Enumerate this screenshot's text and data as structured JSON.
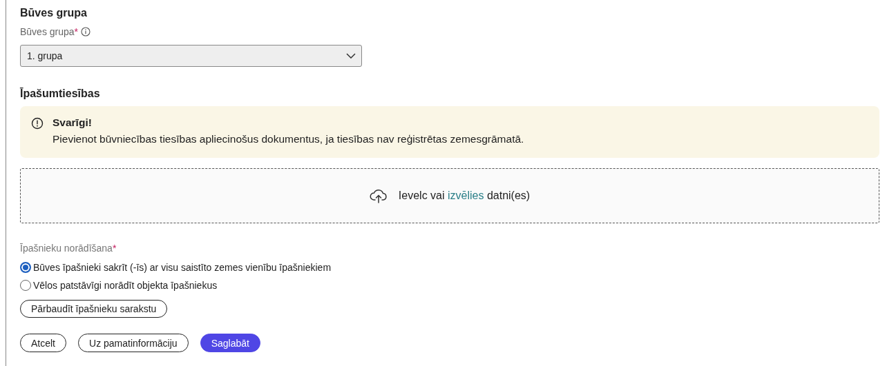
{
  "group_section": {
    "title": "Būves grupa",
    "field": {
      "label": "Būves grupa",
      "required_mark": "*",
      "value": "1. grupa"
    }
  },
  "ownership_section": {
    "title": "Īpašumtiesības",
    "alert": {
      "title": "Svarīgi!",
      "message": "Pievienot būvniecības tiesības apliecinošus dokumentus, ja tiesības nav reģistrētas zemesgrāmatā."
    },
    "dropzone": {
      "before": "Ievelc vai",
      "link": "izvēlies",
      "after": "datni(es)"
    },
    "owners": {
      "label": "Īpašnieku norādīšana",
      "required_mark": "*",
      "options": [
        {
          "label": "Būves īpašnieki sakrīt (-īs) ar visu saistīto zemes vienību īpašniekiem",
          "selected": true
        },
        {
          "label": "Vēlos patstāvīgi norādīt objekta īpašniekus",
          "selected": false
        }
      ]
    },
    "check_button": "Pārbaudīt īpašnieku sarakstu"
  },
  "actions": [
    {
      "label": "Atcelt",
      "kind": "outline"
    },
    {
      "label": "Uz pamatinformāciju",
      "kind": "outline"
    },
    {
      "label": "Saglabāt",
      "kind": "primary"
    }
  ]
}
